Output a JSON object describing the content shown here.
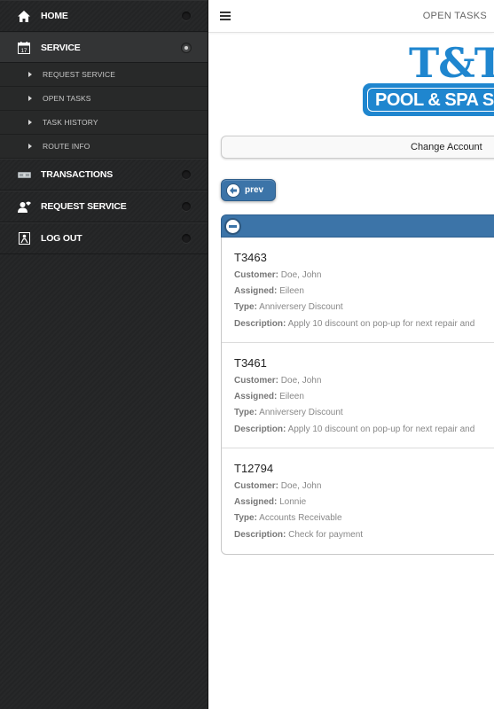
{
  "sidebar": {
    "items": [
      {
        "label": "HOME",
        "icon": "home-icon"
      },
      {
        "label": "SERVICE",
        "icon": "calendar-icon",
        "active": true,
        "subitems": [
          {
            "label": "REQUEST SERVICE"
          },
          {
            "label": "OPEN TASKS"
          },
          {
            "label": "TASK HISTORY"
          },
          {
            "label": "ROUTE INFO"
          }
        ]
      },
      {
        "label": "TRANSACTIONS",
        "icon": "money-icon"
      },
      {
        "label": "REQUEST SERVICE",
        "icon": "person-icon"
      },
      {
        "label": "LOG OUT",
        "icon": "logout-icon"
      }
    ]
  },
  "header": {
    "title": "OPEN TASKS",
    "menu_icon": "hamburger-icon"
  },
  "logo": {
    "top_text": "T&T",
    "band_text": "POOL & SPA SERVICE"
  },
  "buttons": {
    "change_account": "Change Account",
    "prev": "prev"
  },
  "field_labels": {
    "customer": "Customer:",
    "assigned": "Assigned:",
    "type": "Type:",
    "description": "Description:"
  },
  "tasks": [
    {
      "id": "T3463",
      "customer": "Doe, John",
      "assigned": "Eileen",
      "type": "Anniversery Discount",
      "description": "Apply 10 discount on pop-up for next repair and"
    },
    {
      "id": "T3461",
      "customer": "Doe, John",
      "assigned": "Eileen",
      "type": "Anniversery Discount",
      "description": "Apply 10 discount on pop-up for next repair and"
    },
    {
      "id": "T12794",
      "customer": "Doe, John",
      "assigned": "Lonnie",
      "type": "Accounts Receivable",
      "description": "Check for payment"
    }
  ],
  "colors": {
    "sidebar_bg": "#232425",
    "accent_blue": "#3c74a8",
    "logo_blue": "#1f86cf"
  }
}
